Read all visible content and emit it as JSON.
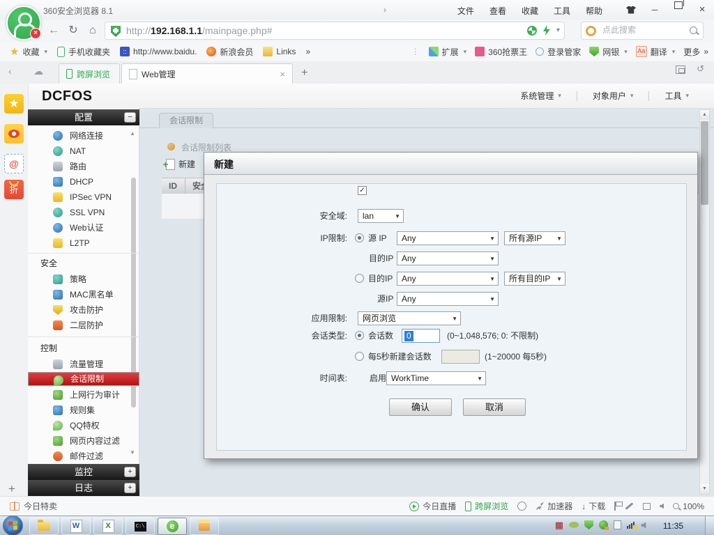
{
  "icons": {
    "chevron": "›",
    "back": "←",
    "refresh": "↻",
    "dropdown": "▾",
    "select_arrow": "▼",
    "close": "×",
    "minimize": "─",
    "plus": "+",
    "more": "»",
    "up": "▲",
    "down": "▼",
    "star": "★",
    "check": "✓",
    "restore": "↺",
    "left_collapse": "‹",
    "minus": "−",
    "at": "@",
    "zhe": "折",
    "search_prompt_dot": "O",
    "home": "⌂",
    "cloud": "☁",
    "download": "↓",
    "dots": "⋮",
    "word": "W",
    "excel": "X",
    "cmd": "C:\\",
    "e360": "e",
    "grid_red": "▦"
  },
  "colors": {
    "accent_green": "#2fa94c",
    "selected_red": "#b21212",
    "selection_blue": "#2e7fd8",
    "list_dot_orange": "#cf9340"
  },
  "browser": {
    "title": "360安全浏览器 8.1",
    "menus": [
      "文件",
      "查看",
      "收藏",
      "工具",
      "帮助"
    ],
    "url_prefix": "http://",
    "url_host": "192.168.1.1",
    "url_path": "/mainpage.php#",
    "search_placeholder": "点此搜索",
    "bookmarks": [
      "收藏",
      "手机收藏夹",
      "http://www.baidu.",
      "新浪会员",
      "Links"
    ],
    "ext_items": [
      "扩展",
      "360抢票王",
      "登录管家",
      "网银",
      "翻译",
      "更多"
    ],
    "tab_mobile": "跨屏浏览",
    "tab_web": "Web管理",
    "bottom_left": "今日特卖",
    "bottom_items": [
      "今日直播",
      "跨屏浏览",
      "加速器",
      "下载"
    ],
    "zoom": "100%"
  },
  "page": {
    "logo": "DCFOS",
    "menus": [
      "系统管理",
      "对象用户",
      "工具"
    ],
    "sidebar": {
      "header_config": "配置",
      "items_config": [
        "网络连接",
        "NAT",
        "路由",
        "DHCP",
        "IPSec VPN",
        "SSL VPN",
        "Web认证",
        "L2TP"
      ],
      "label_security": "安全",
      "items_security": [
        "策略",
        "MAC黑名单",
        "攻击防护",
        "二层防护"
      ],
      "label_control": "控制",
      "items_control": [
        "流量管理",
        "会话限制",
        "上网行为审计",
        "规则集",
        "QQ特权",
        "网页内容过滤",
        "邮件过滤"
      ],
      "header_monitor": "监控",
      "header_log": "日志"
    },
    "content": {
      "tab": "会话限制",
      "list_title": "会话限制列表",
      "new_button": "新建",
      "col_id": "ID",
      "col_zone": "安全"
    }
  },
  "modal": {
    "title": "新建",
    "zone_label": "安全域:",
    "zone_value": "lan",
    "ip_label": "IP限制:",
    "src_ip": "源 IP",
    "dst_ip": "目的IP",
    "src_ip_short": "源IP",
    "any": "Any",
    "all_src": "所有源IP",
    "all_dst": "所有目的IP",
    "app_label": "应用限制:",
    "app_value": "网页浏览",
    "type_label": "会话类型:",
    "count_label": "会话数",
    "count_value": "0",
    "count_hint": "(0~1,048,576; 0: 不限制)",
    "rate_label": "每5秒新建会话数",
    "rate_hint": "(1~20000 每5秒)",
    "schedule_label": "时间表:",
    "enable": "启用",
    "schedule_value": "WorkTime",
    "confirm": "确认",
    "cancel": "取消"
  },
  "taskbar": {
    "time": "11:35"
  }
}
